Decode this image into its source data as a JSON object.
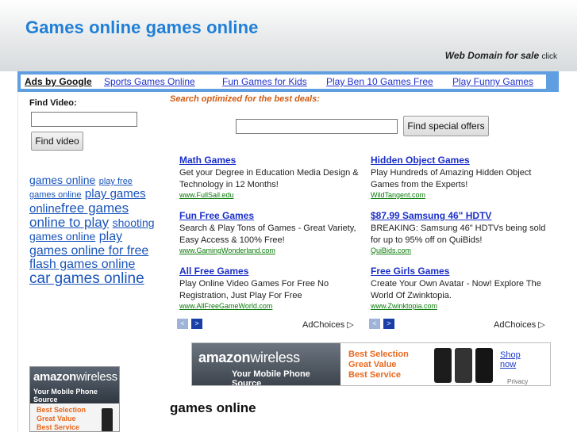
{
  "header": {
    "title": "Games online games online",
    "sale_bold": "Web Domain for sale",
    "sale_click": "click"
  },
  "adbar": {
    "ads_by": "Ads by Google",
    "links": [
      "Sports Games Online",
      "Fun Games for Kids",
      "Play Ben 10 Games Free",
      "Play Funny Games"
    ]
  },
  "sidebar": {
    "find_label": "Find Video:",
    "find_value": "",
    "find_button": "Find video",
    "tags": [
      {
        "text": "games online",
        "size": "14px"
      },
      {
        "text": "play free games online",
        "size": "11px"
      },
      {
        "text": "play games online",
        "size": "15px"
      },
      {
        "text": "free games online to play",
        "size": "17px"
      },
      {
        "text": "shooting games online",
        "size": "14px"
      },
      {
        "text": "play games online for free",
        "size": "16px"
      },
      {
        "text": "flash games online",
        "size": "16px"
      },
      {
        "text": "car games online",
        "size": "19px"
      }
    ],
    "amazon": {
      "logo_bold": "amazon",
      "logo_light": "wireless",
      "tagline": "Your Mobile Phone Source",
      "features": [
        "Best Selection",
        "Great Value",
        "Best Service"
      ]
    }
  },
  "main": {
    "search_note": "Search optimized for the best deals:",
    "search_value": "",
    "search_button": "Find special offers",
    "ads_left": [
      {
        "title": "Math Games",
        "desc": "Get your Degree in Education Media Design & Technology in 12 Months!",
        "url": "www.FullSail.edu"
      },
      {
        "title": "Fun Free Games",
        "desc": "Search & Play Tons of Games - Great Variety, Easy Access & 100% Free!",
        "url": "www.GamingWonderland.com"
      },
      {
        "title": "All Free Games",
        "desc": "Play Online Video Games For Free No Registration, Just Play For Free",
        "url": "www.AllFreeGameWorld.com"
      }
    ],
    "ads_right": [
      {
        "title": "Hidden Object Games",
        "desc": "Play Hundreds of Amazing Hidden Object Games from the Experts!",
        "url": "WildTangent.com"
      },
      {
        "title": "$87.99 Samsung 46\" HDTV",
        "desc": "BREAKING: Samsung 46\" HDTVs being sold for up to 95% off on QuiBids!",
        "url": "QuiBids.com"
      },
      {
        "title": "Free Girls Games",
        "desc": "Create Your Own Avatar - Now! Explore The World Of Zwinktopia.",
        "url": "www.Zwinktopia.com"
      }
    ],
    "nav_prev": "<",
    "nav_next": ">",
    "adchoices": "AdChoices",
    "adchoices_icon": "play-triangle-icon",
    "banner": {
      "logo_bold": "amazon",
      "logo_light": "wireless",
      "tagline": "Your Mobile Phone Source",
      "features": [
        "Best Selection",
        "Great Value",
        "Best Service"
      ],
      "shop_line1": "Shop",
      "shop_line2": "now",
      "privacy": "Privacy"
    },
    "section_title": "games online"
  },
  "colors": {
    "title_blue": "#1f7fd6",
    "link_blue": "#1a55bb",
    "ad_title_blue": "#1a2fc8",
    "url_green": "#0a7a0a",
    "orange": "#d05a10",
    "adbar_blue": "#5f9ee0"
  }
}
